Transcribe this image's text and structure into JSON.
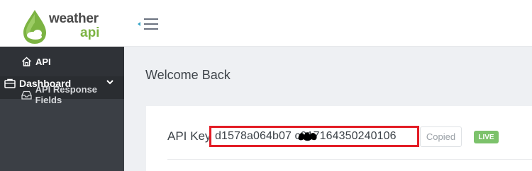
{
  "logo": {
    "line1": "weather",
    "line2": "api"
  },
  "sidebar": {
    "dashboard_label": "Dashboard",
    "items": [
      {
        "label": "API",
        "icon": "home-icon",
        "active": true
      },
      {
        "label": "API Response Fields",
        "icon": "inbox-icon",
        "active": false
      }
    ]
  },
  "main": {
    "title": "Welcome Back",
    "api_key_label": "API Key",
    "api_key_value": "d1578a064b07       c917164350240106",
    "copied_label": "Copied",
    "status_badge": "LIVE"
  },
  "colors": {
    "accent_green": "#7cb342",
    "highlight_red": "#e31c25",
    "sidebar_dark": "#3b3f45"
  }
}
